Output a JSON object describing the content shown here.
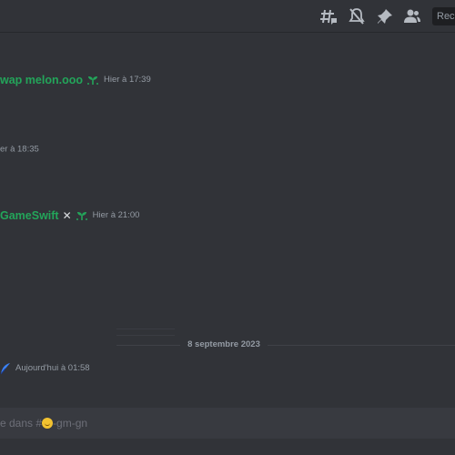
{
  "header": {
    "icons": [
      "threads-icon",
      "mute-bell-icon",
      "pin-icon",
      "members-icon"
    ],
    "search_placeholder": "Rech"
  },
  "messages": [
    {
      "author": "wap melon.ooo",
      "timestamp": "Hier à 17:39",
      "author_color": "#23a55a"
    },
    {
      "author": "",
      "timestamp": "er à 18:35",
      "author_color": "#23a55a"
    },
    {
      "author": "GameSwift",
      "author_suffix": "✕",
      "timestamp": "Hier à 21:00",
      "author_color": "#23a55a"
    },
    {
      "author": "",
      "timestamp": "Aujourd'hui à 01:58",
      "author_color": "#5865f2"
    }
  ],
  "divider": {
    "date": "8 septembre 2023"
  },
  "composer": {
    "placeholder_prefix": "e dans #",
    "placeholder_suffix": "-gm-gn"
  },
  "colors": {
    "background": "#313338",
    "accent_green": "#23a55a",
    "muted": "#949ba4"
  }
}
